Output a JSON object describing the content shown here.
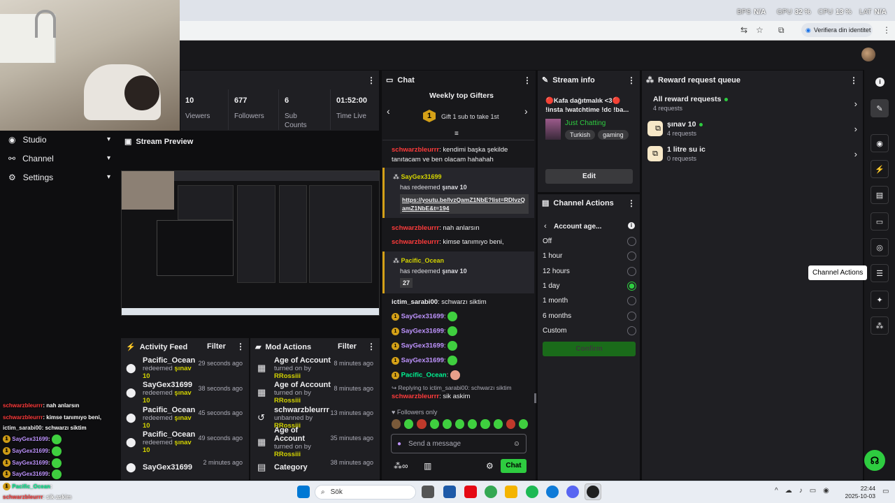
{
  "browser": {
    "perf": [
      {
        "label": "BPS",
        "value": "N/A"
      },
      {
        "label": "GPU",
        "value": "32 %"
      },
      {
        "label": "CPU",
        "value": "13 %"
      },
      {
        "label": "LAT",
        "value": "N/A"
      }
    ],
    "identity_label": "Verifiera din identitet"
  },
  "stats": [
    {
      "value": "10",
      "label": "Viewers"
    },
    {
      "value": "677",
      "label": "Followers"
    },
    {
      "value": "6",
      "label": "Sub Counts"
    },
    {
      "value": "01:52:00",
      "label": "Time Live"
    }
  ],
  "nav": [
    {
      "label": "Studio"
    },
    {
      "label": "Channel"
    },
    {
      "label": "Settings"
    }
  ],
  "preview": {
    "title": "Stream Preview"
  },
  "activity": {
    "title": "Activity Feed",
    "filter": "Filter",
    "rows": [
      {
        "name": "Pacific_Ocean",
        "action": "redeemed",
        "reward": "şınav 10",
        "ago": "29 seconds ago"
      },
      {
        "name": "SayGex31699",
        "action": "redeemed",
        "reward": "şınav 10",
        "ago": "38 seconds ago"
      },
      {
        "name": "Pacific_Ocean",
        "action": "redeemed",
        "reward": "şınav 10",
        "ago": "45 seconds ago"
      },
      {
        "name": "Pacific_Ocean",
        "action": "redeemed",
        "reward": "şınav 10",
        "ago": "49 seconds ago"
      },
      {
        "name": "SayGex31699",
        "action": "",
        "reward": "",
        "ago": "2 minutes ago"
      }
    ]
  },
  "mod": {
    "title": "Mod Actions",
    "filter": "Filter",
    "rows": [
      {
        "name": "Age of Account",
        "action": "turned on by",
        "by": "RRossiii",
        "ago": "8 minutes ago"
      },
      {
        "name": "Age of Account",
        "action": "turned on by",
        "by": "RRossiii",
        "ago": "8 minutes ago"
      },
      {
        "name": "schwarzbleurrr",
        "action": "unbanned by",
        "by": "RRossiii",
        "ago": "13 minutes ago"
      },
      {
        "name": "Age of Account",
        "action": "turned on by",
        "by": "RRossiii",
        "ago": "35 minutes ago"
      },
      {
        "name": "Category",
        "action": "",
        "by": "",
        "ago": "38 minutes ago"
      }
    ]
  },
  "chat": {
    "title": "Chat",
    "gifters_title": "Weekly top Gifters",
    "gifters_text": "Gift 1 sub to take 1st",
    "msg1_user": "schwarzbleurrr",
    "msg1_text": ": kendimi başka şekilde tanıtacam ve ben olacam hahahah",
    "redeem1_user": "SayGex31699",
    "redeem1_text": "has redeemed",
    "redeem1_reward": "şınav 10",
    "redeem1_link": "https://youtu.be/lvzQamZ1NbE?list=RDlvzQamZ1NbE&t=194",
    "msg2_user": "schwarzbleurrr",
    "msg2_text": ": nah anlarsın",
    "msg3_user": "schwarzbleurrr",
    "msg3_text": ": kimse tanımıyo beni,",
    "redeem2_user": "Pacific_Ocean",
    "redeem2_text": "has redeemed",
    "redeem2_reward": "şınav 10",
    "redeem2_value": "27",
    "msg4_user": "ictim_sarabi00",
    "msg4_text": ": schwarzı siktim",
    "emote_lines": [
      {
        "user": "SayGex31699"
      },
      {
        "user": "SayGex31699"
      },
      {
        "user": "SayGex31699"
      },
      {
        "user": "SayGex31699"
      },
      {
        "user": "Pacific_Ocean"
      }
    ],
    "reply_text": "Replying to ictim_sarabi00: schwarzı siktim",
    "msg5_user": "schwarzbleurrr",
    "msg5_text": ": sik askim",
    "followers_only": "Followers only",
    "placeholder": "Send a message",
    "send_label": "Chat"
  },
  "stream_info": {
    "title": "Stream info",
    "stream_title": "🔴Kafa dağıtmalık <3🔴 !insta !watchtime !dc !ba...",
    "category": "Just Chatting",
    "tags": [
      "Turkish",
      "gaming"
    ],
    "edit_label": "Edit"
  },
  "channel_actions": {
    "title": "Channel Actions",
    "subtitle": "Account age...",
    "options": [
      "Off",
      "1 hour",
      "12 hours",
      "1 day",
      "1 month",
      "6 months",
      "Custom"
    ],
    "selected": "1 day",
    "confirm_label": "Confirm"
  },
  "reward_queue": {
    "title": "Reward request queue",
    "all_label": "All reward requests",
    "all_count": "4 requests",
    "items": [
      {
        "name": "şınav 10",
        "count": "4 requests"
      },
      {
        "name": "1 litre su ic",
        "count": "0 requests"
      }
    ]
  },
  "tooltip": "Channel Actions",
  "overlay_chat": [
    {
      "user": "schwarzbleurrr",
      "text": ": nah anlarsın",
      "color": "red"
    },
    {
      "user": "schwarzbleurrr",
      "text": ": kimse tanımıyo beni,",
      "color": "red"
    },
    {
      "user": "ictim_sarabi00",
      "text": ": schwarzı siktim",
      "color": "white"
    },
    {
      "user": "SayGex31699",
      "text": ":",
      "color": "purple"
    },
    {
      "user": "SayGex31699",
      "text": ":",
      "color": "purple"
    },
    {
      "user": "SayGex31699",
      "text": ":",
      "color": "purple"
    },
    {
      "user": "SayGex31699",
      "text": ":",
      "color": "purple"
    },
    {
      "user": "Pacific_Ocean",
      "text": ":",
      "color": "green"
    },
    {
      "user": "schwarzbleurrr",
      "text": ": sik askim",
      "color": "red"
    }
  ],
  "taskbar": {
    "search": "Sök",
    "time": "22:44",
    "date": "2025-10-03"
  },
  "colors": {
    "accent": "#2ecc40",
    "bg": "#0e0e10",
    "panel": "#1f1f23",
    "purple": "#bf94ff"
  }
}
